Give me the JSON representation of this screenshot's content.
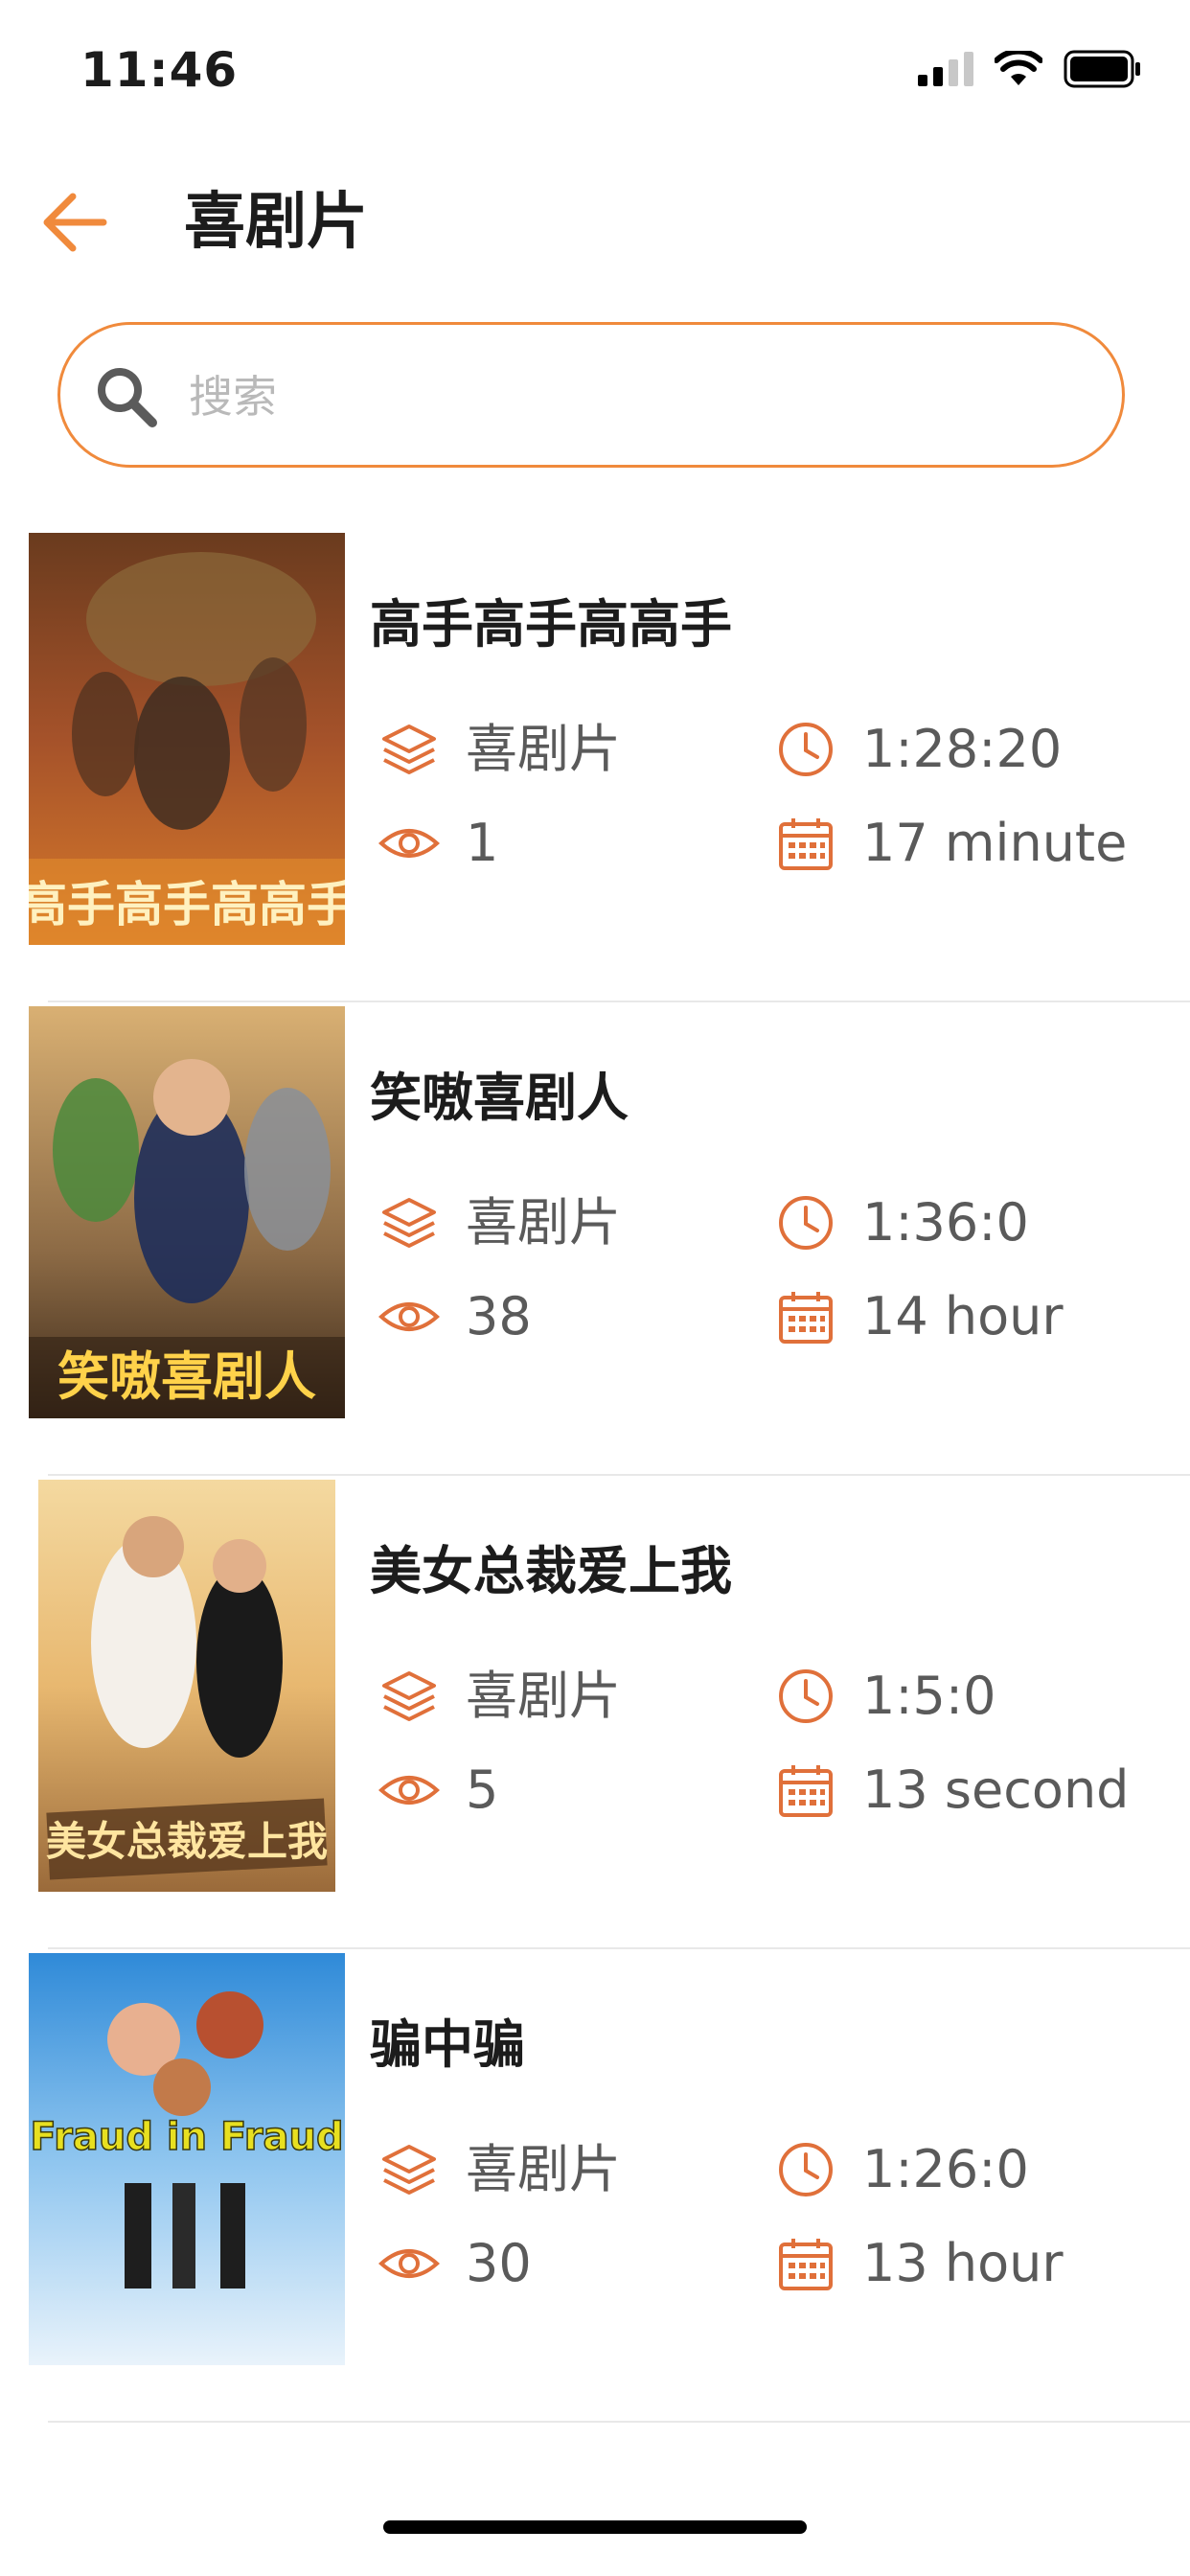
{
  "status_bar": {
    "time": "11:46"
  },
  "header": {
    "title": "喜剧片"
  },
  "search": {
    "placeholder": "搜索",
    "value": ""
  },
  "colors": {
    "accent": "#f08a3c",
    "icon": "#e0703a"
  },
  "movies": [
    {
      "title": "高手高手高高手",
      "genre": "喜剧片",
      "views": "1",
      "duration": "1:28:20",
      "time_ago": "17 minute",
      "poster_text": "高手高手高高手"
    },
    {
      "title": "笑嗷喜剧人",
      "genre": "喜剧片",
      "views": "38",
      "duration": "1:36:0",
      "time_ago": "14 hour",
      "poster_text": "笑嗷喜剧人"
    },
    {
      "title": "美女总裁爱上我",
      "genre": "喜剧片",
      "views": "5",
      "duration": "1:5:0",
      "time_ago": "13 second",
      "poster_text": "美女总裁爱上我"
    },
    {
      "title": "骗中骗",
      "genre": "喜剧片",
      "views": "30",
      "duration": "1:26:0",
      "time_ago": "13 hour",
      "poster_text": "Fraud in Fraud"
    }
  ]
}
